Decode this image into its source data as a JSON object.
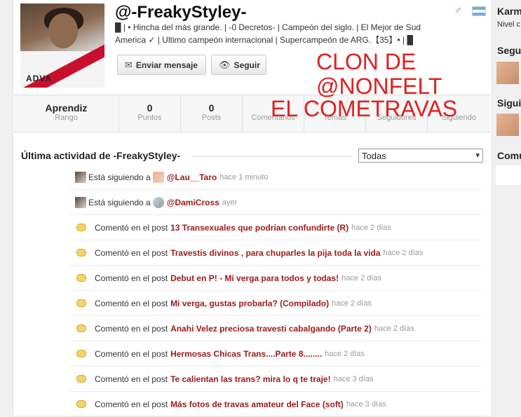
{
  "profile": {
    "username": "@-FreakyStyley-",
    "bio": "█ | • Hincha del más grande. | -0 Decretos- | Campeón del siglo. | El Mejor de Sud America ✓ | Ultimo campeón internacional | Supercampeón de ARG.【35】• | █",
    "gender_icon": "♂",
    "avatar_text": "ADVA",
    "buttons": {
      "message": "Enviar mensaje",
      "follow": "Seguir"
    }
  },
  "overlay": {
    "line1": "CLON DE",
    "line2": "@NONFELT",
    "line3": "EL COMETRAVAS"
  },
  "stats": [
    {
      "value": "Aprendiz",
      "label": "Rango"
    },
    {
      "value": "0",
      "label": "Puntos"
    },
    {
      "value": "0",
      "label": "Posts"
    },
    {
      "value": "",
      "label": "Comentarios"
    },
    {
      "value": "",
      "label": "Temas"
    },
    {
      "value": "",
      "label": "Seguidores"
    },
    {
      "value": "",
      "label": "Siguiendo"
    }
  ],
  "activity": {
    "title": "Última actividad de -FreakyStyley-",
    "filter": "Todas",
    "rows": [
      {
        "prefix": "Está siguiendo a",
        "target": "@Lau__Taro",
        "time": "hace 1 minuto"
      },
      {
        "prefix": "Está siguiendo a",
        "target": "@DamiCross",
        "time": "ayer"
      },
      {
        "prefix": "Comentó en el post",
        "target": "13 Transexuales que podrian confundirte (R)",
        "time": "hace 2 días"
      },
      {
        "prefix": "Comentó en el post",
        "target": "Travestis divinos , para chuparles la pija toda la vida",
        "time": "hace 2 días"
      },
      {
        "prefix": "Comentó en el post",
        "target": "Debut en P! - Mi verga para todos y todas!",
        "time": "hace 2 días"
      },
      {
        "prefix": "Comentó en el post",
        "target": "Mi verga, gustas probarla? (Compilado)",
        "time": "hace 2 días"
      },
      {
        "prefix": "Comentó en el post",
        "target": "Anahi Velez preciosa travesti cabalgando (Parte 2)",
        "time": "hace 2 días"
      },
      {
        "prefix": "Comentó en el post",
        "target": "Hermosas Chicas Trans....Parte 8........",
        "time": "hace 2 días"
      },
      {
        "prefix": "Comentó en el post",
        "target": "Te calientan las trans? mira lo q te traje!",
        "time": "hace 3 días"
      },
      {
        "prefix": "Comentó en el post",
        "target": "Más fotos de travas amateur del Face (soft)",
        "time": "hace 3 días"
      }
    ]
  },
  "sidebar": {
    "karma_title": "Karm",
    "karma_sub": "Nivel c",
    "followers_title": "Segu",
    "following_title": "Sigui",
    "communities_title": "Comu"
  }
}
